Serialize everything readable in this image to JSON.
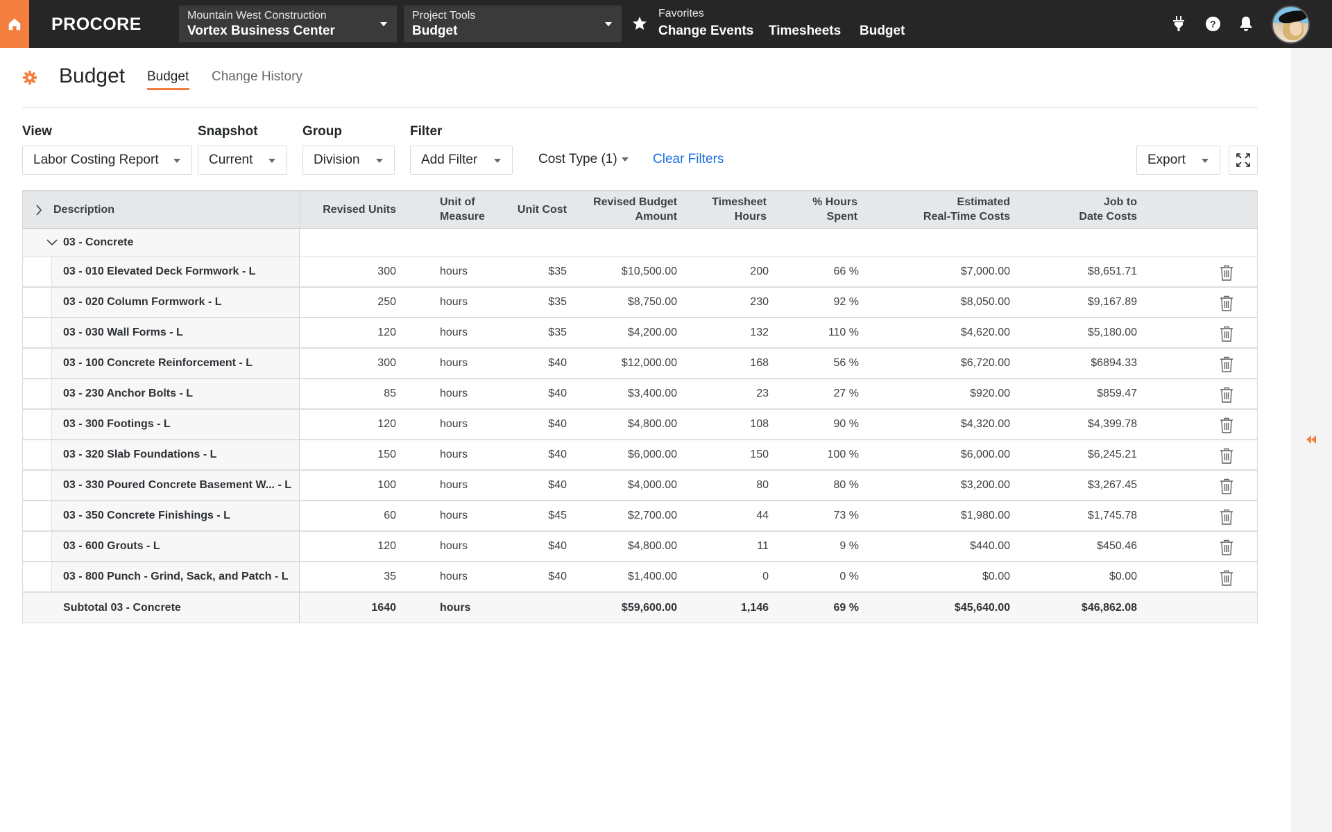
{
  "navbar": {
    "brand": "PROCORE",
    "company": {
      "label": "Mountain West Construction",
      "value": "Vortex Business Center"
    },
    "tool": {
      "label": "Project Tools",
      "value": "Budget"
    },
    "favorites": {
      "label": "Favorites",
      "links": [
        "Change Events",
        "Timesheets",
        "Budget"
      ]
    },
    "icons": [
      "home-icon",
      "star-icon",
      "plug-icon",
      "help-icon",
      "bell-icon"
    ]
  },
  "page": {
    "title": "Budget",
    "tabs": [
      {
        "label": "Budget",
        "active": true
      },
      {
        "label": "Change History",
        "active": false
      }
    ]
  },
  "filters": {
    "view": {
      "label": "View",
      "value": "Labor Costing Report"
    },
    "snapshot": {
      "label": "Snapshot",
      "value": "Current"
    },
    "group": {
      "label": "Group",
      "value": "Division"
    },
    "filter": {
      "label": "Filter",
      "value": "Add Filter"
    },
    "cost_type": "Cost Type (1)",
    "clear_filters": "Clear Filters",
    "export": "Export"
  },
  "table": {
    "columns": {
      "description": "Description",
      "revised_units": "Revised Units",
      "uom_1": "Unit of",
      "uom_2": "Measure",
      "unit_cost": "Unit Cost",
      "rba_1": "Revised Budget",
      "rba_2": "Amount",
      "tsh_1": "Timesheet",
      "tsh_2": "Hours",
      "phs_1": "% Hours",
      "phs_2": "Spent",
      "ertc_1": "Estimated",
      "ertc_2": "Real-Time Costs",
      "jtd_1": "Job to",
      "jtd_2": "Date Costs"
    },
    "group": "03 - Concrete",
    "rows": [
      {
        "description": "03 - 010 Elevated Deck Formwork - L",
        "revised_units": "300",
        "uom": "hours",
        "unit_cost": "$35",
        "revised_budget": "$10,500.00",
        "timesheet_hours": "200",
        "pct_hours": "66 %",
        "est_costs": "$7,000.00",
        "jtd_costs": "$8,651.71"
      },
      {
        "description": "03 - 020 Column Formwork - L",
        "revised_units": "250",
        "uom": "hours",
        "unit_cost": "$35",
        "revised_budget": "$8,750.00",
        "timesheet_hours": "230",
        "pct_hours": "92 %",
        "est_costs": "$8,050.00",
        "jtd_costs": "$9,167.89"
      },
      {
        "description": "03 - 030 Wall Forms - L",
        "revised_units": "120",
        "uom": "hours",
        "unit_cost": "$35",
        "revised_budget": "$4,200.00",
        "timesheet_hours": "132",
        "pct_hours": "110 %",
        "est_costs": "$4,620.00",
        "jtd_costs": "$5,180.00"
      },
      {
        "description": "03 - 100 Concrete Reinforcement - L",
        "revised_units": "300",
        "uom": "hours",
        "unit_cost": "$40",
        "revised_budget": "$12,000.00",
        "timesheet_hours": "168",
        "pct_hours": "56 %",
        "est_costs": "$6,720.00",
        "jtd_costs": "$6894.33"
      },
      {
        "description": "03 - 230 Anchor Bolts - L",
        "revised_units": "85",
        "uom": "hours",
        "unit_cost": "$40",
        "revised_budget": "$3,400.00",
        "timesheet_hours": "23",
        "pct_hours": "27 %",
        "est_costs": "$920.00",
        "jtd_costs": "$859.47"
      },
      {
        "description": "03 - 300 Footings - L",
        "revised_units": "120",
        "uom": "hours",
        "unit_cost": "$40",
        "revised_budget": "$4,800.00",
        "timesheet_hours": "108",
        "pct_hours": "90 %",
        "est_costs": "$4,320.00",
        "jtd_costs": "$4,399.78"
      },
      {
        "description": "03 - 320 Slab Foundations - L",
        "revised_units": "150",
        "uom": "hours",
        "unit_cost": "$40",
        "revised_budget": "$6,000.00",
        "timesheet_hours": "150",
        "pct_hours": "100 %",
        "est_costs": "$6,000.00",
        "jtd_costs": "$6,245.21"
      },
      {
        "description": "03 - 330 Poured Concrete Basement W... - L",
        "revised_units": "100",
        "uom": "hours",
        "unit_cost": "$40",
        "revised_budget": "$4,000.00",
        "timesheet_hours": "80",
        "pct_hours": "80 %",
        "est_costs": "$3,200.00",
        "jtd_costs": "$3,267.45"
      },
      {
        "description": "03 - 350 Concrete Finishings - L",
        "revised_units": "60",
        "uom": "hours",
        "unit_cost": "$45",
        "revised_budget": "$2,700.00",
        "timesheet_hours": "44",
        "pct_hours": "73 %",
        "est_costs": "$1,980.00",
        "jtd_costs": "$1,745.78"
      },
      {
        "description": "03 - 600 Grouts - L",
        "revised_units": "120",
        "uom": "hours",
        "unit_cost": "$40",
        "revised_budget": "$4,800.00",
        "timesheet_hours": "11",
        "pct_hours": "9 %",
        "est_costs": "$440.00",
        "jtd_costs": "$450.46"
      },
      {
        "description": "03 - 800 Punch - Grind, Sack, and Patch - L",
        "revised_units": "35",
        "uom": "hours",
        "unit_cost": "$40",
        "revised_budget": "$1,400.00",
        "timesheet_hours": "0",
        "pct_hours": "0 %",
        "est_costs": "$0.00",
        "jtd_costs": "$0.00"
      }
    ],
    "subtotal": {
      "description": "Subtotal 03 - Concrete",
      "revised_units": "1640",
      "uom": "hours",
      "unit_cost": "",
      "revised_budget": "$59,600.00",
      "timesheet_hours": "1,146",
      "pct_hours": "69 %",
      "est_costs": "$45,640.00",
      "jtd_costs": "$46,862.08"
    }
  },
  "colors": {
    "brand_orange": "#f47e3e",
    "navbar_bg": "#262626",
    "link_blue": "#1d6fde",
    "table_header_bg": "#e6e7e8"
  }
}
